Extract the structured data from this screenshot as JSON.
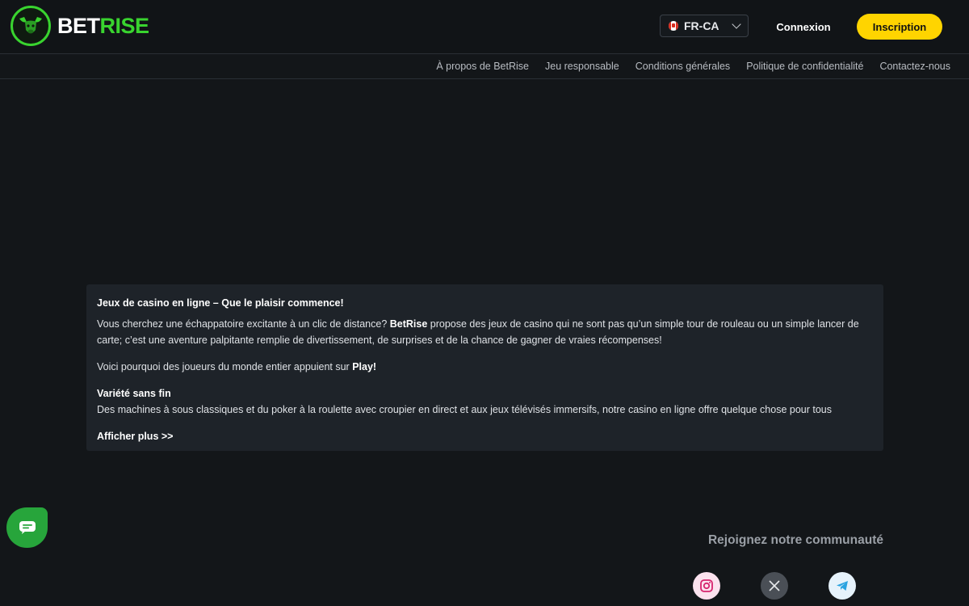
{
  "header": {
    "logo": {
      "part1": "BET",
      "part2": "RISE"
    },
    "language": {
      "label": "FR-CA"
    },
    "login_label": "Connexion",
    "signup_label": "Inscription"
  },
  "subnav": {
    "items": [
      "À propos de BetRise",
      "Jeu responsable",
      "Conditions générales",
      "Politique de confidentialité",
      "Contactez-nous"
    ]
  },
  "content": {
    "title": "Jeux de casino en ligne – Que le plaisir commence!",
    "para1_before": "Vous cherchez une échappatoire excitante à un clic de distance? ",
    "para1_brand": "BetRise",
    "para1_after": " propose des jeux de casino qui ne sont pas qu’un simple tour de rouleau ou un simple lancer de carte; c’est une aventure palpitante remplie de divertissement, de surprises et de la chance de gagner de vraies récompenses!",
    "para2_before": "Voici pourquoi des joueurs du monde entier appuient sur ",
    "para2_bold": "Play!",
    "subheading": "Variété sans fin",
    "para3": "Des machines à sous classiques et du poker à la roulette avec croupier en direct et aux jeux télévisés immersifs, notre casino en ligne offre quelque chose pour tous",
    "show_more": "Afficher plus >>"
  },
  "community": {
    "title": "Rejoignez notre communauté",
    "icons": [
      "instagram-icon",
      "x-icon",
      "telegram-icon"
    ]
  },
  "colors": {
    "accent_green": "#39d42f",
    "signup_yellow": "#ffd400",
    "background": "#131619",
    "card": "#1e2329"
  }
}
